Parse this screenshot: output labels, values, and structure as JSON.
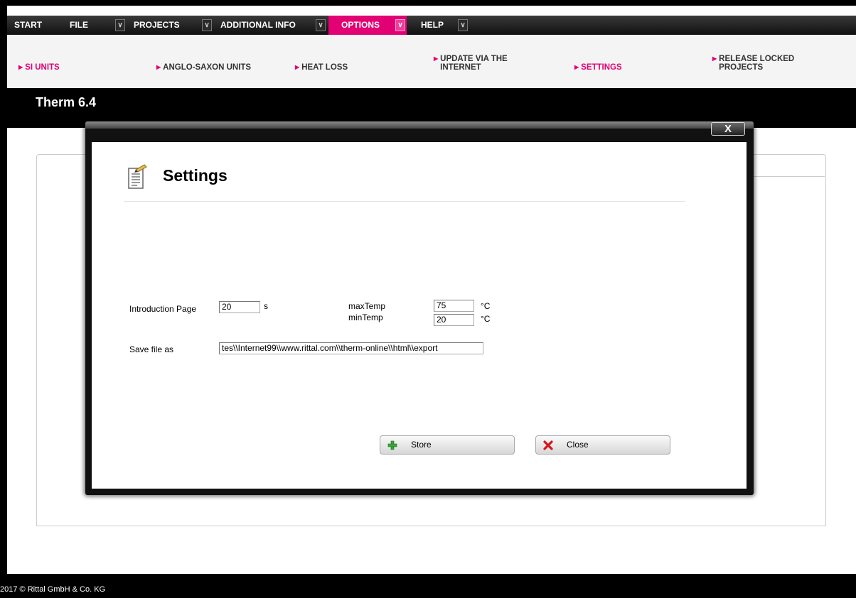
{
  "menu": {
    "items": [
      {
        "label": "START",
        "has_arrow": false,
        "active": false
      },
      {
        "label": "FILE",
        "has_arrow": true,
        "active": false
      },
      {
        "label": "PROJECTS",
        "has_arrow": true,
        "active": false
      },
      {
        "label": "ADDITIONAL INFO",
        "has_arrow": true,
        "active": false
      },
      {
        "label": "OPTIONS",
        "has_arrow": true,
        "active": true
      },
      {
        "label": "HELP",
        "has_arrow": true,
        "active": false
      }
    ],
    "arrow_icon": "chevron-down-icon"
  },
  "submenu": {
    "items": [
      {
        "label": "SI UNITS",
        "active": true
      },
      {
        "label": "ANGLO-SAXON UNITS",
        "active": false
      },
      {
        "label": "HEAT LOSS",
        "active": false
      },
      {
        "label": "UPDATE VIA THE\nINTERNET",
        "active": false
      },
      {
        "label": "SETTINGS",
        "active": true
      },
      {
        "label": "RELEASE LOCKED\nPROJECTS",
        "active": false
      }
    ]
  },
  "app": {
    "title": "Therm 6.4",
    "footer": "2017 © Rittal GmbH & Co. KG"
  },
  "dialog": {
    "close_label": "X",
    "title": "Settings",
    "title_icon": "settings-notepad-icon",
    "intro_page_label": "Introduction Page",
    "intro_page_value": "20",
    "intro_page_unit": "s",
    "max_temp_label": "maxTemp",
    "max_temp_value": "75",
    "max_temp_unit": "°C",
    "min_temp_label": "minTemp",
    "min_temp_value": "20",
    "min_temp_unit": "°C",
    "save_file_label": "Save file as",
    "save_file_value": "tes\\\\Internet99\\\\www.rittal.com\\\\therm-online\\\\html\\\\export",
    "store_label": "Store",
    "store_icon": "plus-icon",
    "close_button_label": "Close",
    "close_button_icon": "red-x-icon"
  },
  "colors": {
    "accent": "#e20074",
    "menubar": "#1a1a1a",
    "title_band": "#000000"
  }
}
